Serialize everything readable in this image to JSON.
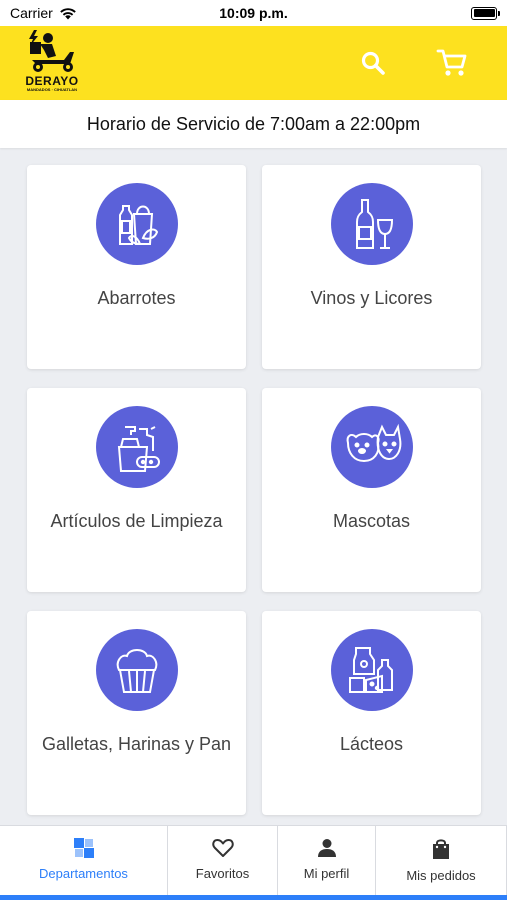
{
  "status_bar": {
    "carrier": "Carrier",
    "time": "10:09 p.m."
  },
  "header": {
    "logo_title": "DERAYO",
    "logo_subtitle": "MANDADOS · CIHUATLAN",
    "search_icon": "search-icon",
    "cart_icon": "cart-icon",
    "background_color": "#fde11f"
  },
  "schedule": {
    "text": "Horario de Servicio de 7:00am a 22:00pm"
  },
  "categories": [
    {
      "label": "Abarrotes",
      "icon": "groceries-icon"
    },
    {
      "label": "Vinos y Licores",
      "icon": "wine-bottle-icon"
    },
    {
      "label": "Artículos de Limpieza",
      "icon": "cleaning-supplies-icon"
    },
    {
      "label": "Mascotas",
      "icon": "pets-icon"
    },
    {
      "label": "Galletas, Harinas y Pan",
      "icon": "cupcake-icon"
    },
    {
      "label": "Lácteos",
      "icon": "dairy-icon"
    }
  ],
  "tabs": [
    {
      "label": "Departamentos",
      "icon": "departments-icon",
      "active": true
    },
    {
      "label": "Favoritos",
      "icon": "heart-icon",
      "active": false
    },
    {
      "label": "Mi perfil",
      "icon": "person-icon",
      "active": false
    },
    {
      "label": "Mis pedidos",
      "icon": "shopping-bag-icon",
      "active": false
    }
  ],
  "colors": {
    "accent": "#2d7ff9",
    "category_circle": "#5b61d9",
    "header": "#fde11f"
  }
}
